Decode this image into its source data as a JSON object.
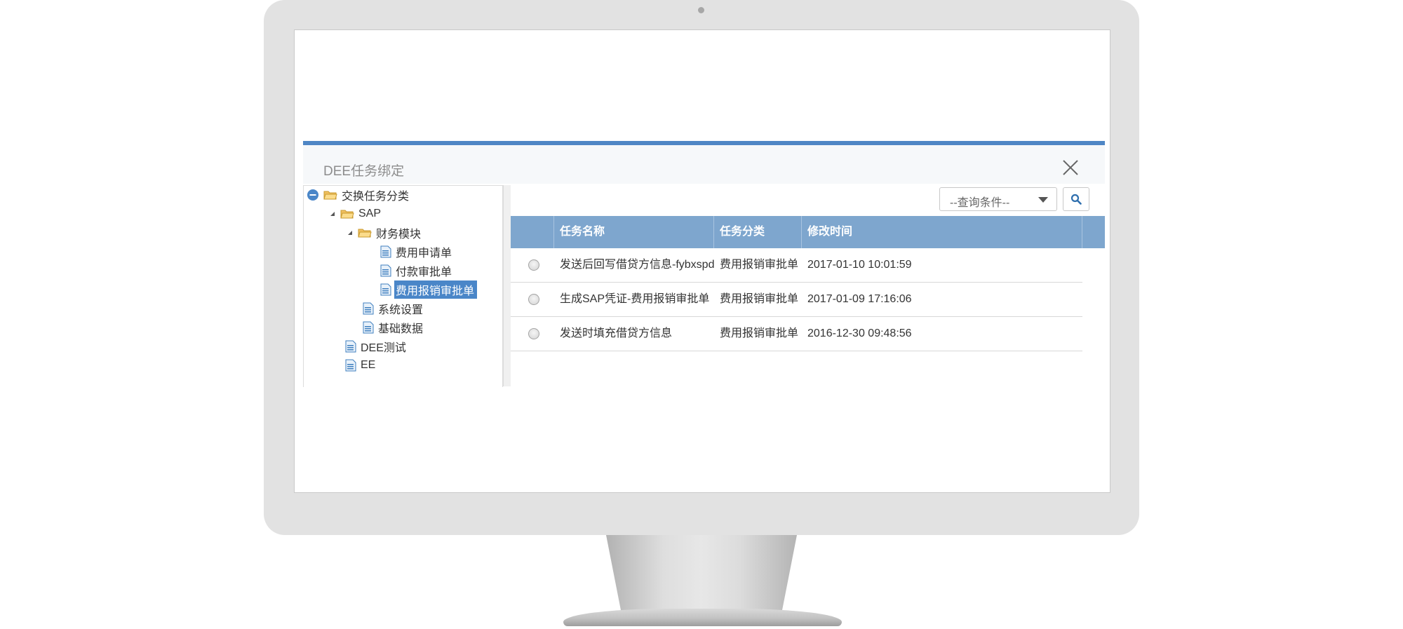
{
  "dialog": {
    "title": "DEE任务绑定"
  },
  "tree": {
    "root": "交换任务分类",
    "sap": "SAP",
    "finance": "财务模块",
    "fee_apply": "费用申请单",
    "payment": "付款审批单",
    "expense": "费用报销审批单",
    "system": "系统设置",
    "basic_data": "基础数据",
    "dee_test": "DEE测试",
    "ee": "EE"
  },
  "toolbar": {
    "query_placeholder": "--查询条件--"
  },
  "grid": {
    "columns": [
      "任务名称",
      "任务分类",
      "修改时间"
    ],
    "rows": [
      {
        "name": "发送后回写借贷方信息-fybxspd",
        "category": "费用报销审批单",
        "modified": "2017-01-10 10:01:59"
      },
      {
        "name": "生成SAP凭证-费用报销审批单",
        "category": "费用报销审批单",
        "modified": "2017-01-09 17:16:06"
      },
      {
        "name": "发送时填充借贷方信息",
        "category": "费用报销审批单",
        "modified": "2016-12-30 09:48:56"
      }
    ]
  },
  "colors": {
    "accent": "#4f86c5",
    "grid_header": "#7ea6ce",
    "selection": "#4a86c8"
  }
}
